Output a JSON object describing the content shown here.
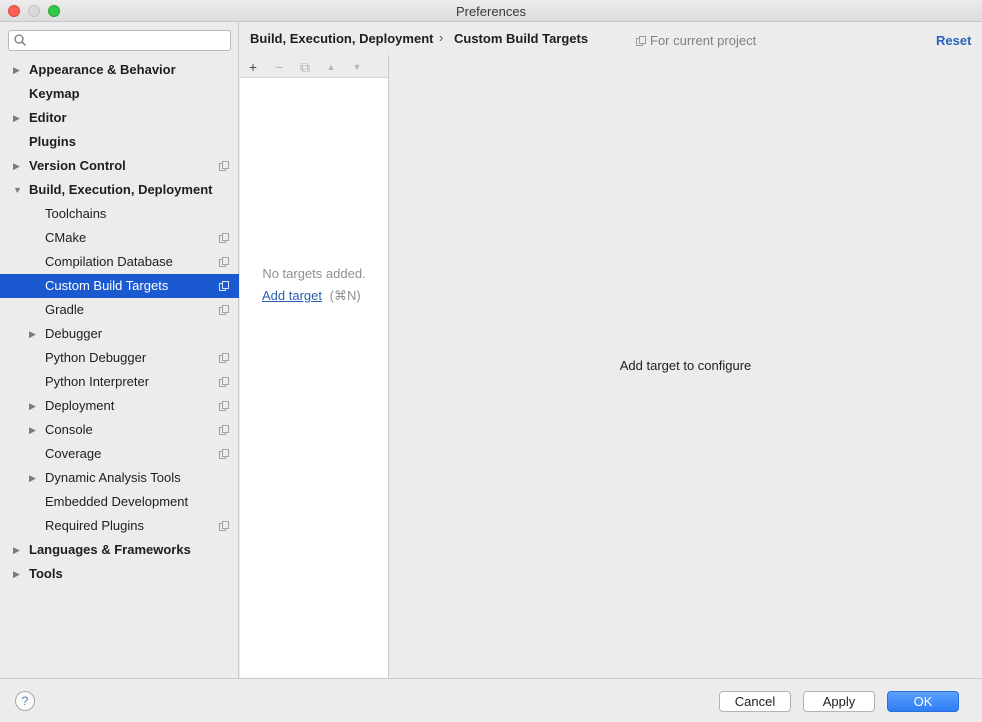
{
  "window": {
    "title": "Preferences"
  },
  "search": {
    "placeholder": "",
    "value": ""
  },
  "sidebar": {
    "items": [
      {
        "label": "Appearance & Behavior",
        "level": 0,
        "bold": true,
        "arrow": "right",
        "scope": false
      },
      {
        "label": "Keymap",
        "level": 0,
        "bold": true,
        "arrow": "none",
        "scope": false
      },
      {
        "label": "Editor",
        "level": 0,
        "bold": true,
        "arrow": "right",
        "scope": false
      },
      {
        "label": "Plugins",
        "level": 0,
        "bold": true,
        "arrow": "none",
        "scope": false
      },
      {
        "label": "Version Control",
        "level": 0,
        "bold": true,
        "arrow": "right",
        "scope": true
      },
      {
        "label": "Build, Execution, Deployment",
        "level": 0,
        "bold": true,
        "arrow": "down",
        "scope": false
      },
      {
        "label": "Toolchains",
        "level": 1,
        "bold": false,
        "arrow": "none",
        "scope": false
      },
      {
        "label": "CMake",
        "level": 1,
        "bold": false,
        "arrow": "none",
        "scope": true
      },
      {
        "label": "Compilation Database",
        "level": 1,
        "bold": false,
        "arrow": "none",
        "scope": true
      },
      {
        "label": "Custom Build Targets",
        "level": 1,
        "bold": false,
        "arrow": "none",
        "scope": true,
        "selected": true
      },
      {
        "label": "Gradle",
        "level": 1,
        "bold": false,
        "arrow": "none",
        "scope": true
      },
      {
        "label": "Debugger",
        "level": 1,
        "bold": false,
        "arrow": "right",
        "scope": false
      },
      {
        "label": "Python Debugger",
        "level": 1,
        "bold": false,
        "arrow": "none",
        "scope": true
      },
      {
        "label": "Python Interpreter",
        "level": 1,
        "bold": false,
        "arrow": "none",
        "scope": true
      },
      {
        "label": "Deployment",
        "level": 1,
        "bold": false,
        "arrow": "right",
        "scope": true
      },
      {
        "label": "Console",
        "level": 1,
        "bold": false,
        "arrow": "right",
        "scope": true
      },
      {
        "label": "Coverage",
        "level": 1,
        "bold": false,
        "arrow": "none",
        "scope": true
      },
      {
        "label": "Dynamic Analysis Tools",
        "level": 1,
        "bold": false,
        "arrow": "right",
        "scope": false
      },
      {
        "label": "Embedded Development",
        "level": 1,
        "bold": false,
        "arrow": "none",
        "scope": false
      },
      {
        "label": "Required Plugins",
        "level": 1,
        "bold": false,
        "arrow": "none",
        "scope": true
      },
      {
        "label": "Languages & Frameworks",
        "level": 0,
        "bold": true,
        "arrow": "right",
        "scope": false
      },
      {
        "label": "Tools",
        "level": 0,
        "bold": true,
        "arrow": "right",
        "scope": false
      }
    ]
  },
  "header": {
    "breadcrumb_parent": "Build, Execution, Deployment",
    "breadcrumb_separator": "›",
    "breadcrumb_current": "Custom Build Targets",
    "scope_label": "For current project",
    "reset_label": "Reset"
  },
  "targets": {
    "toolbar": [
      {
        "name": "add-icon",
        "glyph": "+",
        "enabled": true
      },
      {
        "name": "remove-icon",
        "glyph": "−",
        "enabled": false
      },
      {
        "name": "copy-icon",
        "glyph": "⧉",
        "enabled": false
      },
      {
        "name": "move-up-icon",
        "glyph": "▲",
        "enabled": false
      },
      {
        "name": "move-down-icon",
        "glyph": "▼",
        "enabled": false
      }
    ],
    "empty_text": "No targets added.",
    "add_link": "Add target",
    "add_shortcut": "(⌘N)"
  },
  "config": {
    "message": "Add target to configure"
  },
  "footer": {
    "help_label": "?",
    "cancel_label": "Cancel",
    "apply_label": "Apply",
    "ok_label": "OK"
  },
  "colors": {
    "selection": "#1b59d1",
    "link": "#2a5fb0",
    "ok_button": "#2f7df5"
  }
}
